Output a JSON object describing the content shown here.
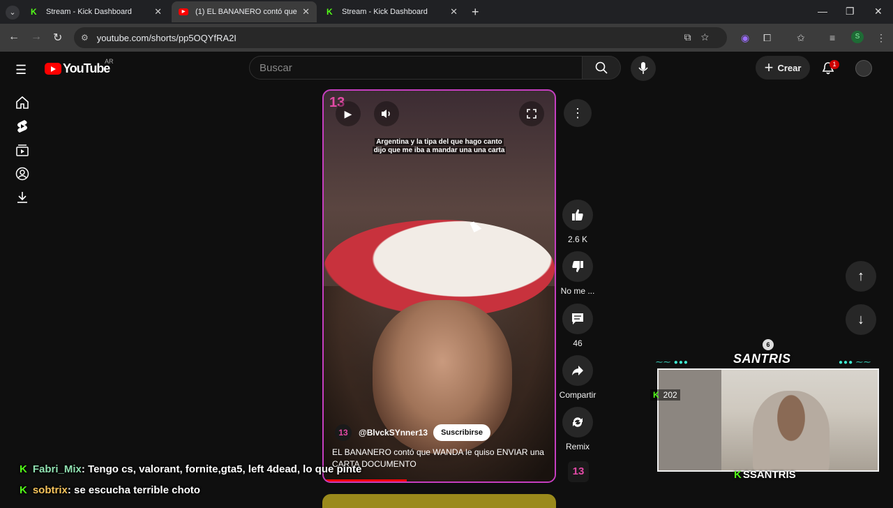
{
  "browser": {
    "tabs": [
      {
        "title": "Stream - Kick Dashboard",
        "favicon": "kick-icon"
      },
      {
        "title": "(1) EL BANANERO contó que W",
        "favicon": "youtube-icon",
        "active": true
      },
      {
        "title": "Stream - Kick Dashboard",
        "favicon": "kick-icon"
      }
    ],
    "url": "youtube.com/shorts/pp5OQYfRA2I",
    "profile_initial": "S"
  },
  "youtube": {
    "logo_text": "YouTube",
    "region": "AR",
    "search_placeholder": "Buscar",
    "create_label": "Crear",
    "notification_count": "1"
  },
  "short": {
    "caption_line1": "Argentina y la tipa del que hago canto",
    "caption_line2": "dijo que me iba a mandar una una carta",
    "channel_logo": "13",
    "channel_name": "@BlvckSYnner13",
    "subscribe_label": "Suscribirse",
    "title": "EL BANANERO contó que WANDA le quiso ENVIAR una CARTA DOCUMENTO",
    "progress": 0.36
  },
  "actions": {
    "likes": "2.6 K",
    "dislike_label": "No me ...",
    "comments": "46",
    "share_label": "Compartir",
    "remix_label": "Remix",
    "channel_thumb": "13"
  },
  "overlay": {
    "streamer_logo": "SANTRIS",
    "crown_number": "6",
    "viewer_count": "202",
    "streamer_name": "SSANTRIS",
    "chat": [
      {
        "user": "Fabri_Mix",
        "message": ": Tengo cs, valorant, fornite,gta5, left 4dead, lo que pinte"
      },
      {
        "user": "sobtrix",
        "message": ": se escucha terrible choto"
      }
    ]
  },
  "colors": {
    "accent": "#ff0000",
    "kick_green": "#53fc18",
    "channel_pink": "#e24aa6"
  }
}
